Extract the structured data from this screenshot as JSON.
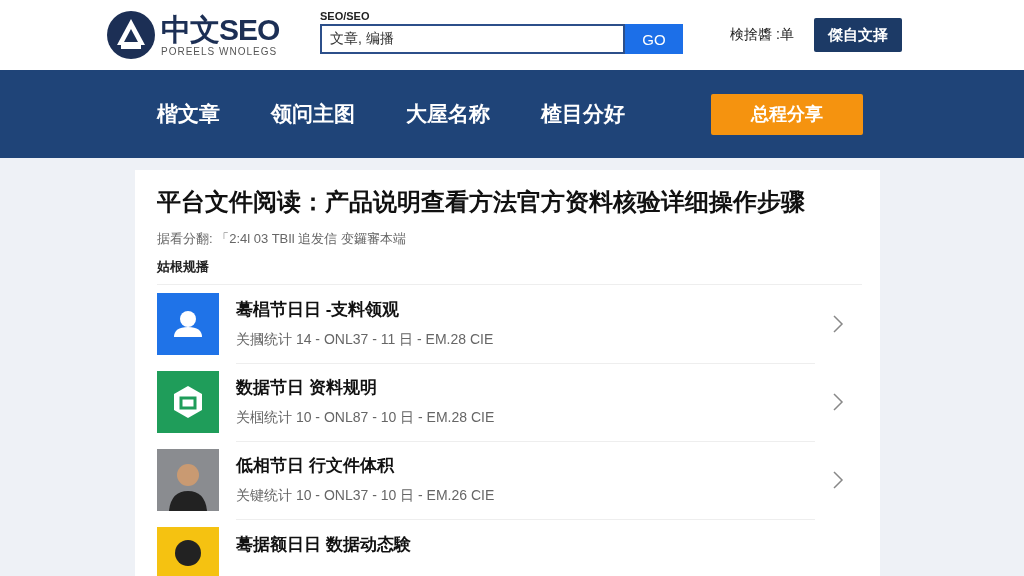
{
  "header": {
    "logo": {
      "title": "中文SEO",
      "subtitle": "POREELS WNOLEGS"
    },
    "search": {
      "label": "SEO/SEO",
      "value": "文章, 编播",
      "button": "GO"
    },
    "user_text": "検捨醬 :单",
    "action_button": "傑自文择"
  },
  "nav": {
    "items": [
      {
        "label": "楷文章"
      },
      {
        "label": "领问主图"
      },
      {
        "label": "大屋名称"
      },
      {
        "label": "楂目分好"
      }
    ],
    "cta": "总程分享"
  },
  "article": {
    "title": "平台文件阅读：产品说明查看方法官方资料核验详细操作步骤",
    "meta": "据看分翻: 「2:4l 03 TBIl 追发信 变鑼審本端",
    "section": "姑根规播",
    "items": [
      {
        "kind": "person",
        "title": "蓦椙节日日 -支料领观",
        "meta": "关摑统计 14 - ONL37 - 11 日 - EM.28 CIE"
      },
      {
        "kind": "hexagon",
        "title": "数据节日 资料规明",
        "meta": "关椢统计 10 - ONL87 - 10 日 - EM.28 CIE"
      },
      {
        "kind": "avatar",
        "title": "低相节日 行文件体积",
        "meta": "关键统计 10 - ONL37 - 10 日 - EM.26 CIE"
      },
      {
        "kind": "avatar-yellow",
        "title": "蓦据额日日 数据动态験"
      }
    ]
  }
}
